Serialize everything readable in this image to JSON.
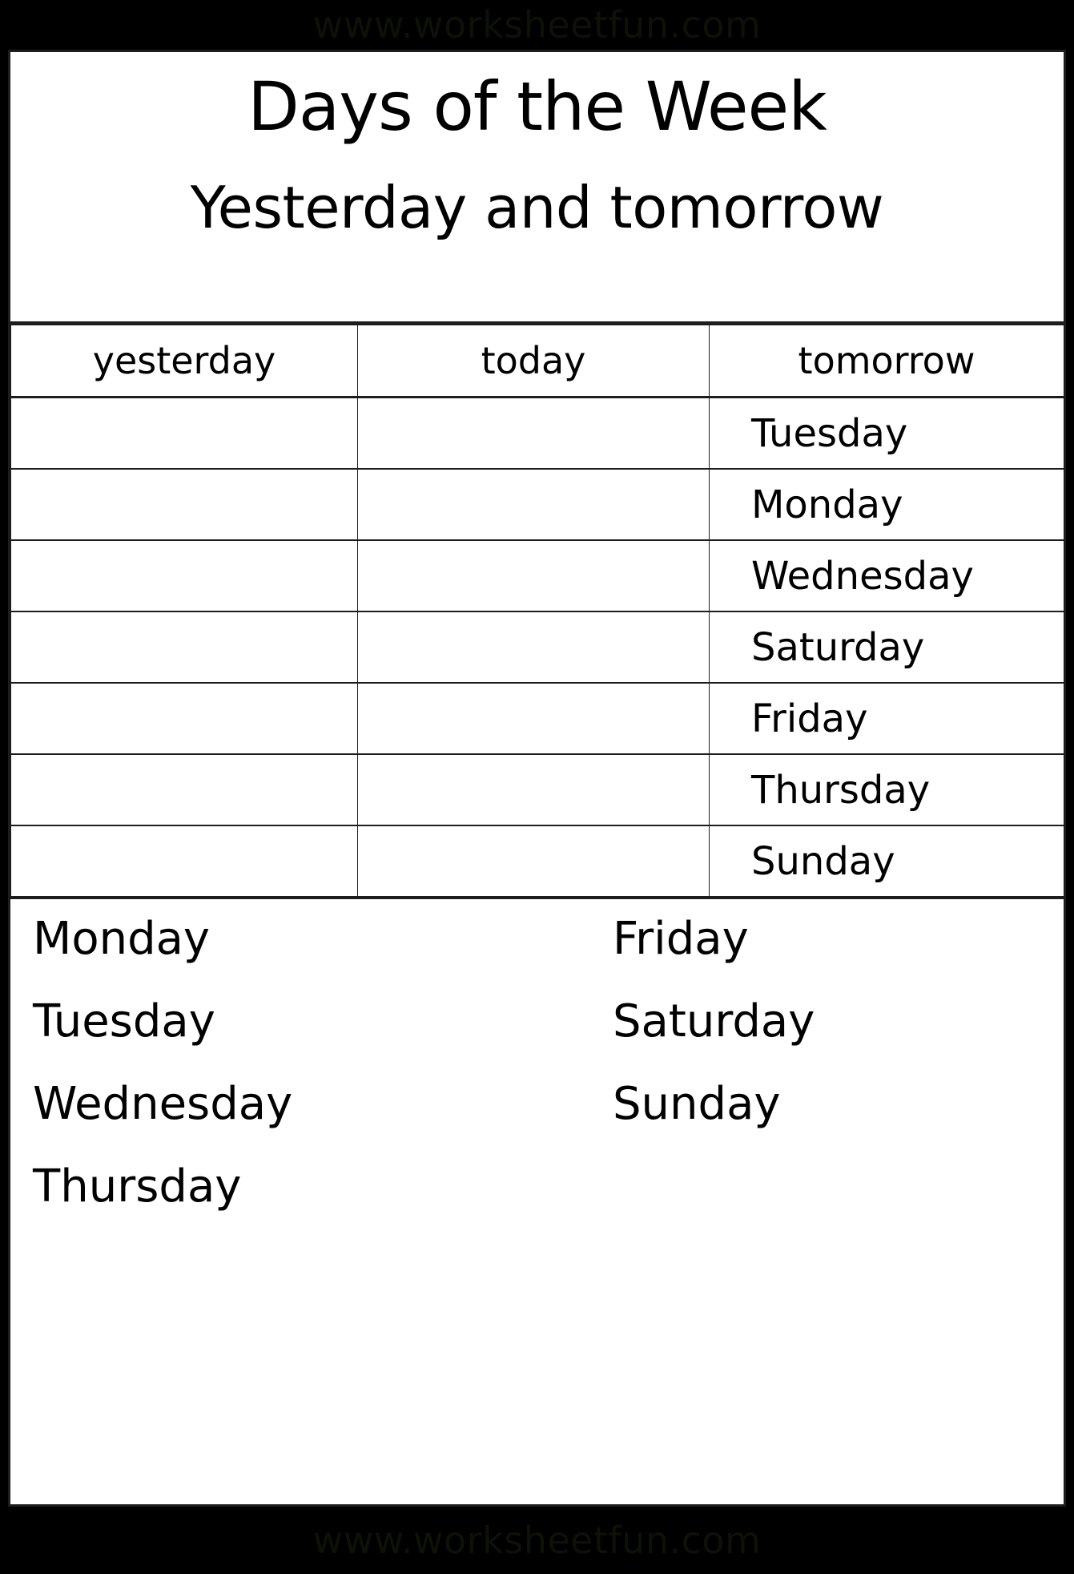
{
  "watermark": {
    "top_text": "www.worksheetfun.com",
    "bottom_text": "www.worksheetfun.com"
  },
  "heading": {
    "title": "Days of the Week",
    "subtitle": "Yesterday and tomorrow"
  },
  "table": {
    "columns": [
      "yesterday",
      "today",
      "tomorrow"
    ],
    "rows": [
      {
        "yesterday": "",
        "today": "",
        "tomorrow": "Tuesday"
      },
      {
        "yesterday": "",
        "today": "",
        "tomorrow": "Monday"
      },
      {
        "yesterday": "",
        "today": "",
        "tomorrow": "Wednesday"
      },
      {
        "yesterday": "",
        "today": "",
        "tomorrow": "Saturday"
      },
      {
        "yesterday": "",
        "today": "",
        "tomorrow": "Friday"
      },
      {
        "yesterday": "",
        "today": "",
        "tomorrow": "Thursday"
      },
      {
        "yesterday": "",
        "today": "",
        "tomorrow": "Sunday"
      }
    ]
  },
  "word_bank": {
    "left_column": [
      "Monday",
      "Tuesday",
      "Wednesday",
      "Thursday"
    ],
    "right_column": [
      "Friday",
      "Saturday",
      "Sunday"
    ]
  },
  "colors": {
    "page_background": "#ffffff",
    "border": "#1d1d1d",
    "outer_background": "#000000",
    "text": "#000000",
    "watermark_text": "#0d1206"
  }
}
